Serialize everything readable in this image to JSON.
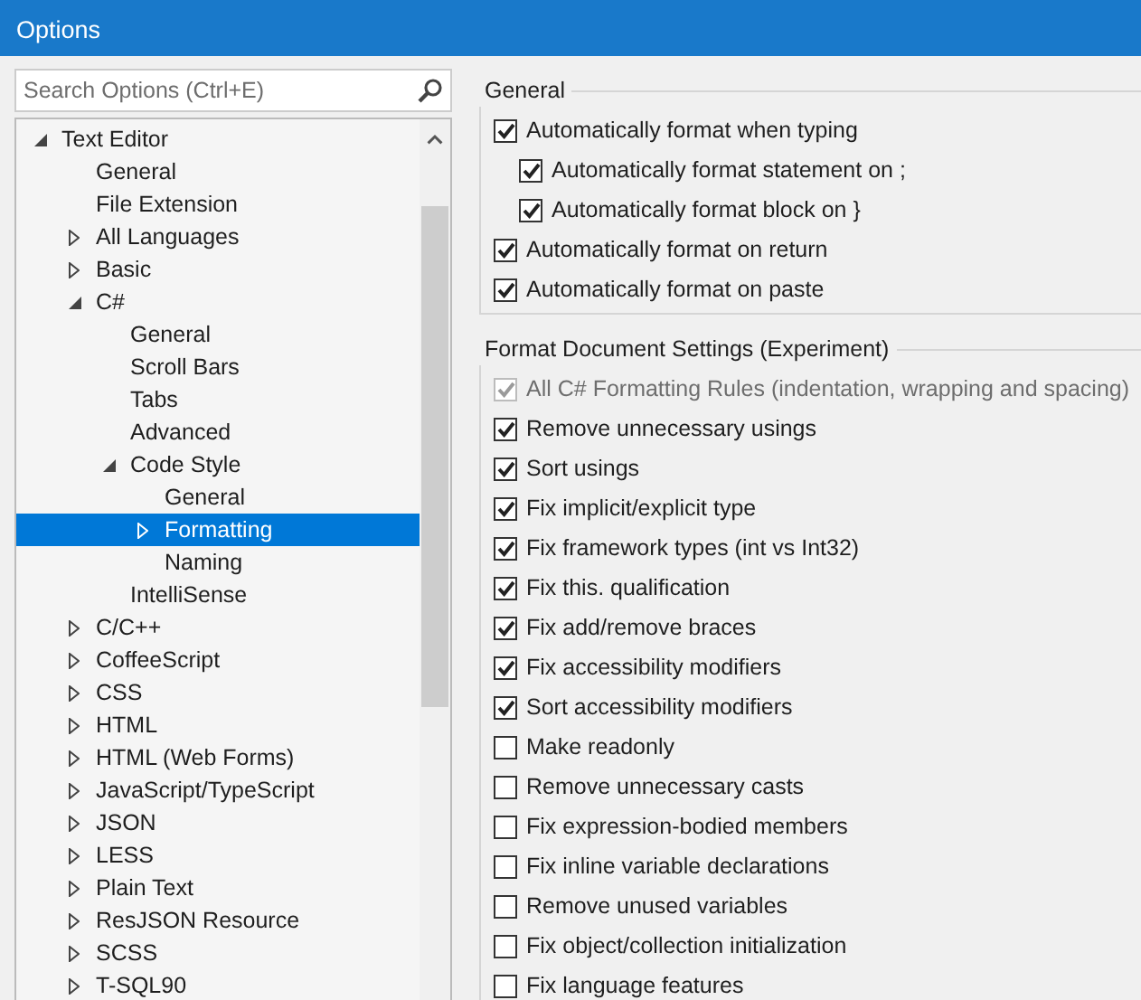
{
  "window": {
    "title": "Options"
  },
  "search": {
    "placeholder": "Search Options (Ctrl+E)"
  },
  "tree": [
    {
      "label": "Text Editor",
      "expanded": true,
      "selected": false,
      "children": [
        {
          "label": "General",
          "selected": false
        },
        {
          "label": "File Extension",
          "selected": false
        },
        {
          "label": "All Languages",
          "expanded": false,
          "selected": false
        },
        {
          "label": "Basic",
          "expanded": false,
          "selected": false
        },
        {
          "label": "C#",
          "expanded": true,
          "selected": false,
          "children": [
            {
              "label": "General",
              "selected": false
            },
            {
              "label": "Scroll Bars",
              "selected": false
            },
            {
              "label": "Tabs",
              "selected": false
            },
            {
              "label": "Advanced",
              "selected": false
            },
            {
              "label": "Code Style",
              "expanded": true,
              "selected": false,
              "children": [
                {
                  "label": "General",
                  "selected": false
                },
                {
                  "label": "Formatting",
                  "expanded": false,
                  "selected": true
                },
                {
                  "label": "Naming",
                  "selected": false
                }
              ]
            },
            {
              "label": "IntelliSense",
              "selected": false
            }
          ]
        },
        {
          "label": "C/C++",
          "expanded": false,
          "selected": false
        },
        {
          "label": "CoffeeScript",
          "expanded": false,
          "selected": false
        },
        {
          "label": "CSS",
          "expanded": false,
          "selected": false
        },
        {
          "label": "HTML",
          "expanded": false,
          "selected": false
        },
        {
          "label": "HTML (Web Forms)",
          "expanded": false,
          "selected": false
        },
        {
          "label": "JavaScript/TypeScript",
          "expanded": false,
          "selected": false
        },
        {
          "label": "JSON",
          "expanded": false,
          "selected": false
        },
        {
          "label": "LESS",
          "expanded": false,
          "selected": false
        },
        {
          "label": "Plain Text",
          "expanded": false,
          "selected": false
        },
        {
          "label": "ResJSON Resource",
          "expanded": false,
          "selected": false
        },
        {
          "label": "SCSS",
          "expanded": false,
          "selected": false
        },
        {
          "label": "T-SQL90",
          "expanded": false,
          "selected": false
        }
      ]
    }
  ],
  "groups": [
    {
      "title": "General",
      "options": [
        {
          "label": "Automatically format when typing",
          "checked": true,
          "disabled": false,
          "children": [
            {
              "label": "Automatically format statement on ;",
              "checked": true,
              "disabled": false
            },
            {
              "label": "Automatically format block on }",
              "checked": true,
              "disabled": false
            }
          ]
        },
        {
          "label": "Automatically format on return",
          "checked": true,
          "disabled": false
        },
        {
          "label": "Automatically format on paste",
          "checked": true,
          "disabled": false
        }
      ]
    },
    {
      "title": "Format Document Settings (Experiment)",
      "options": [
        {
          "label": "All C# Formatting Rules (indentation, wrapping and spacing)",
          "checked": true,
          "disabled": true
        },
        {
          "label": "Remove unnecessary usings",
          "checked": true,
          "disabled": false
        },
        {
          "label": "Sort usings",
          "checked": true,
          "disabled": false
        },
        {
          "label": "Fix implicit/explicit type",
          "checked": true,
          "disabled": false
        },
        {
          "label": "Fix framework types (int vs Int32)",
          "checked": true,
          "disabled": false
        },
        {
          "label": "Fix this. qualification",
          "checked": true,
          "disabled": false
        },
        {
          "label": "Fix add/remove braces",
          "checked": true,
          "disabled": false
        },
        {
          "label": "Fix accessibility modifiers",
          "checked": true,
          "disabled": false
        },
        {
          "label": "Sort accessibility modifiers",
          "checked": true,
          "disabled": false
        },
        {
          "label": "Make readonly",
          "checked": false,
          "disabled": false
        },
        {
          "label": "Remove unnecessary casts",
          "checked": false,
          "disabled": false
        },
        {
          "label": "Fix expression-bodied members",
          "checked": false,
          "disabled": false
        },
        {
          "label": "Fix inline variable declarations",
          "checked": false,
          "disabled": false
        },
        {
          "label": "Remove unused variables",
          "checked": false,
          "disabled": false
        },
        {
          "label": "Fix object/collection initialization",
          "checked": false,
          "disabled": false
        },
        {
          "label": "Fix language features",
          "checked": false,
          "disabled": false
        }
      ]
    }
  ]
}
